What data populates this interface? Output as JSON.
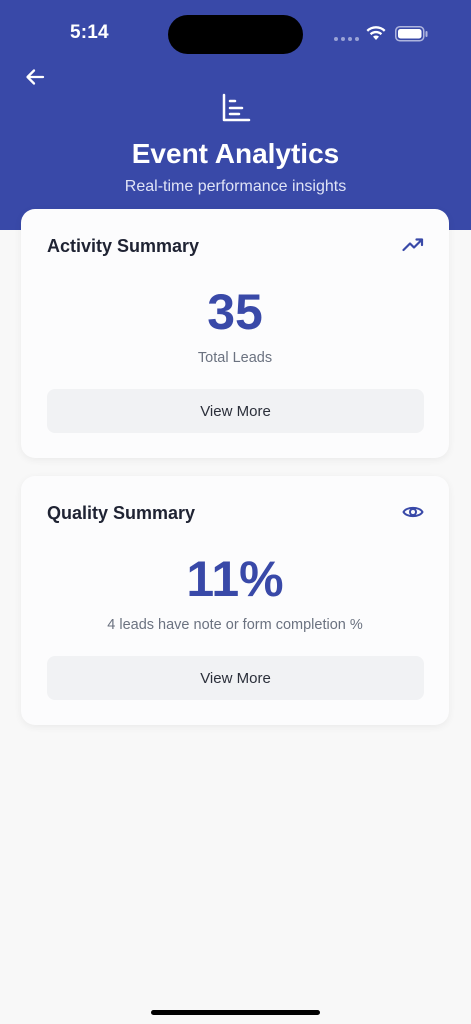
{
  "status_bar": {
    "time": "5:14"
  },
  "header": {
    "title": "Event Analytics",
    "subtitle": "Real-time performance insights",
    "icons": {
      "back": "arrow-left-icon",
      "chart": "bar-chart-icon"
    }
  },
  "activity_summary": {
    "title": "Activity Summary",
    "icon": "trending-up-icon",
    "value": "35",
    "caption": "Total Leads",
    "button_label": "View More"
  },
  "quality_summary": {
    "title": "Quality Summary",
    "icon": "eye-icon",
    "value": "11%",
    "caption": "4 leads have note or form completion %",
    "button_label": "View More"
  },
  "colors": {
    "brand": "#3949a8",
    "background": "#f8f8f8",
    "card": "#fcfcfd",
    "button": "#f1f2f4"
  }
}
